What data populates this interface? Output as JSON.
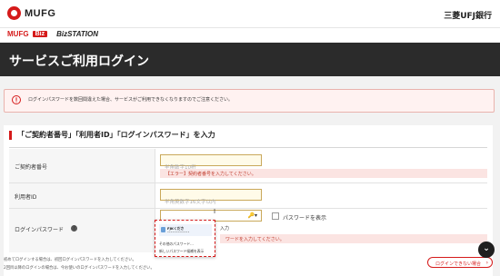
{
  "header": {
    "brand": "MUFG",
    "bank_name": "三菱UFJ銀行"
  },
  "subheader": {
    "mufg": "MUFG",
    "biz": "Biz",
    "bizstation": "BizSTATION"
  },
  "page": {
    "title": "サービスご利用ログイン"
  },
  "notice": {
    "text": "ログインパスワードを数回間違えた場合、サービスがご利用できなくなりますのでご注意ください。"
  },
  "section": {
    "title": "「ご契約者番号」「利用者ID」「ログインパスワード」を入力"
  },
  "fields": {
    "contract": {
      "label": "ご契約者番号",
      "placeholder": "半角数字10桁",
      "error": "【エラー】契約者番号を入力してください。"
    },
    "user_id": {
      "label": "利用者ID",
      "placeholder": "半角英数字16文字以内"
    },
    "password": {
      "label": "ログインパスワード",
      "help": "?",
      "show_label": "パスワードを表示",
      "hint_suffix": "入力",
      "error": "ワードを入力してください。"
    }
  },
  "autofill": {
    "user": "FJKくださ",
    "sub": "•••••••••••••",
    "other": "その他のパスワード...",
    "suggest": "新しいパスワード候補を表示"
  },
  "footer": {
    "note1": "初めてログインする場合は、初回ログインパスワードを入力してください。",
    "note2": "2回目以降のログインの場合は、今お使いのログインパスワードを入力してください。",
    "help_link": "ログインできない場合",
    "help_arrow": "›"
  },
  "scroll_button": {
    "glyph": "⌄"
  },
  "colors": {
    "accent": "#d51a1a",
    "header_bg": "#2b2b2b",
    "field_bg": "#fffbe9",
    "error_text": "#c0392b"
  }
}
